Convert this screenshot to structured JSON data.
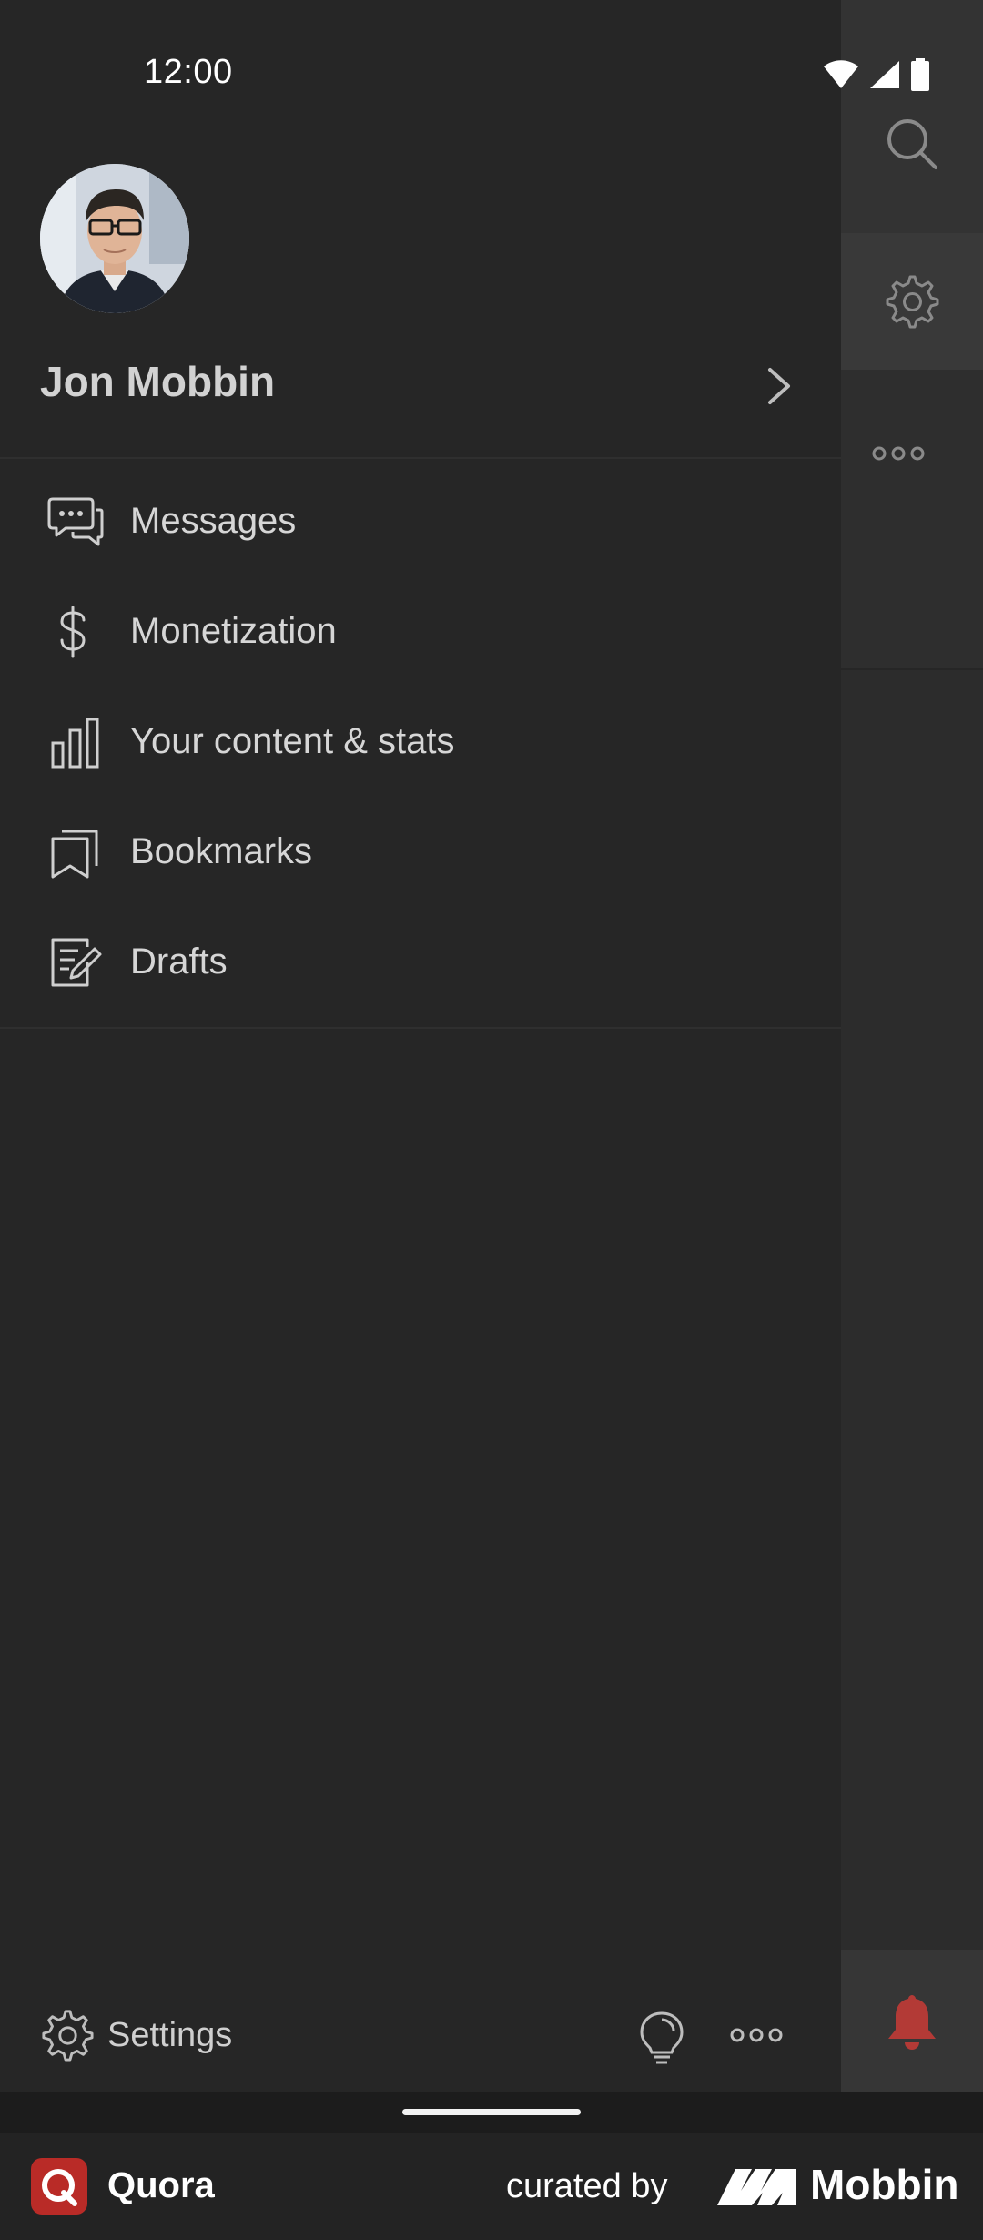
{
  "status_bar": {
    "time": "12:00"
  },
  "profile": {
    "name": "Jon Mobbin"
  },
  "menu": [
    {
      "label": "Messages",
      "icon": "messages-icon"
    },
    {
      "label": "Monetization",
      "icon": "dollar-icon"
    },
    {
      "label": "Your content & stats",
      "icon": "bar-chart-icon"
    },
    {
      "label": "Bookmarks",
      "icon": "bookmarks-icon"
    },
    {
      "label": "Drafts",
      "icon": "drafts-icon"
    }
  ],
  "bottom_bar": {
    "settings_label": "Settings"
  },
  "footer": {
    "app_name": "Quora",
    "curated_by": "curated by",
    "brand": "Mobbin"
  },
  "colors": {
    "background": "#262626",
    "text": "#d6d6d6",
    "quora_red": "#b92b27",
    "bell_red": "#b33a36"
  }
}
